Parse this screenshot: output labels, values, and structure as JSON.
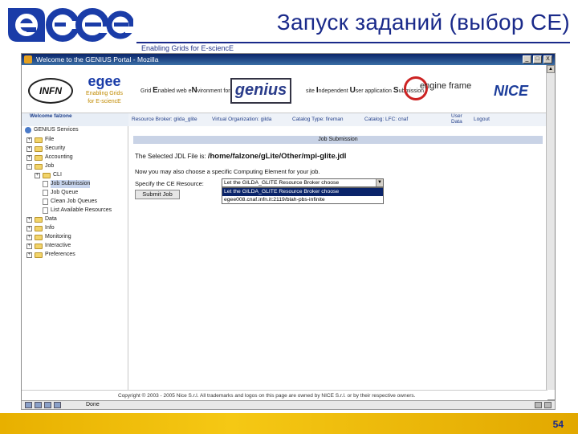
{
  "slide": {
    "title": "Запуск заданий (выбор CE)",
    "tagline": "Enabling Grids for E-sciencE",
    "logo_text": "egee",
    "page_number": "54",
    "colors": {
      "title": "#1a2a8a",
      "footer": "#f5c814",
      "logo_blue": "#1a3ca8"
    }
  },
  "browser": {
    "window_title": "Welcome to the GENIUS Portal - Mozilla",
    "window_buttons": [
      "_",
      "□",
      "X"
    ],
    "status_text": "Done"
  },
  "banner": {
    "infn": "INFN",
    "egee_small": "egee",
    "egee_small_sub": "Enabling Grids for E-sciencE",
    "gen_text_1": "Grid ",
    "gen_text_1b": "E",
    "gen_text_2": "nabled web e",
    "gen_text_2b": "N",
    "gen_text_3": "vironment for",
    "genius": "genius",
    "site_text_1": "site ",
    "site_text_1b": "I",
    "site_text_2": "ndependent ",
    "site_text_2b": "U",
    "site_text_3": "ser application ",
    "site_text_3b": "S",
    "site_text_4": "ubmission",
    "engine": "engine frame",
    "nice": "NICE"
  },
  "linkbar": {
    "resource_broker": "Resource Broker: glida_glite",
    "vo": "Virtual Organization: gilda",
    "catalog_type": "Catalog Type: fireman",
    "catalog": "Catalog: LFC: cnaf",
    "user_data": "User Data",
    "logout": "Logout"
  },
  "nav": {
    "welcome": "Welcome falzone",
    "root": "GENIUS Services",
    "items": [
      {
        "label": "File",
        "kind": "folder",
        "sign": "+",
        "indent": 0
      },
      {
        "label": "Security",
        "kind": "folder",
        "sign": "+",
        "indent": 0
      },
      {
        "label": "Accounting",
        "kind": "folder",
        "sign": "+",
        "indent": 0
      },
      {
        "label": "Job",
        "kind": "folder",
        "sign": "-",
        "indent": 0
      },
      {
        "label": "CLI",
        "kind": "folder",
        "sign": "+",
        "indent": 1
      },
      {
        "label": "Job Submission",
        "kind": "doc",
        "sign": "",
        "indent": 1
      },
      {
        "label": "Job Queue",
        "kind": "doc",
        "sign": "",
        "indent": 1
      },
      {
        "label": "Clean Job Queues",
        "kind": "doc",
        "sign": "",
        "indent": 1
      },
      {
        "label": "List Available Resources",
        "kind": "doc",
        "sign": "",
        "indent": 1
      },
      {
        "label": "Data",
        "kind": "folder",
        "sign": "+",
        "indent": 0
      },
      {
        "label": "Info",
        "kind": "folder",
        "sign": "+",
        "indent": 0
      },
      {
        "label": "Monitoring",
        "kind": "folder",
        "sign": "+",
        "indent": 0
      },
      {
        "label": "Interactive",
        "kind": "folder",
        "sign": "+",
        "indent": 0
      },
      {
        "label": "Preferences",
        "kind": "folder",
        "sign": "+",
        "indent": 0
      }
    ]
  },
  "content": {
    "section_title": "Job Submission",
    "jdl_label": "The Selected JDL File is: ",
    "jdl_path": "/home/falzone/gLite/Other/mpi-glite.jdl",
    "ce_prompt": "Now you may also choose a specific Computing Element for your job.",
    "specify_label": "Specify the CE Resource:",
    "select_value": "Let the GILDA_GLITE Resource Broker choose",
    "options": [
      "Let the GILDA_GLITE Resource Broker choose",
      "egee008.cnaf.infn.it:2119/blah-pbs-infinite"
    ],
    "submit_label": "Submit Job",
    "copyright": "Copyright © 2003 - 2005 Nice S.r.l. All trademarks and logos on this page are owned by NICE S.r.l. or by their respective owners."
  }
}
